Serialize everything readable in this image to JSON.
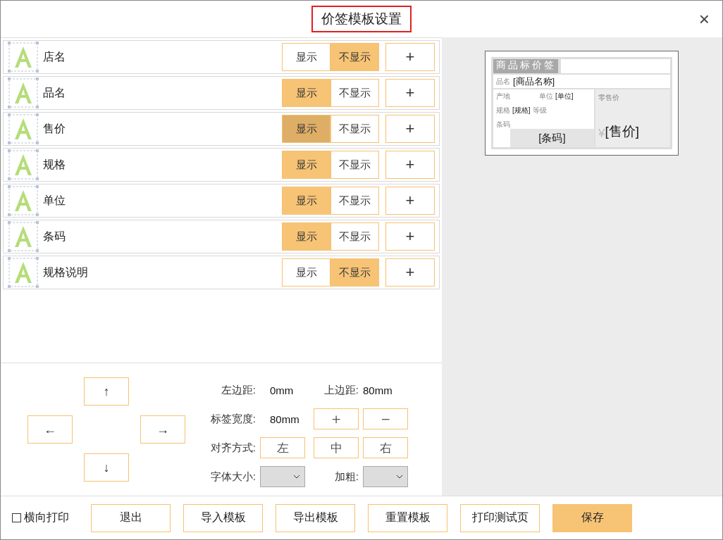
{
  "window": {
    "title": "价签模板设置",
    "close": "×"
  },
  "fields": [
    {
      "name": "店名",
      "show_label": "显示",
      "hide_label": "不显示",
      "shown": false,
      "hovered": false,
      "add": "+"
    },
    {
      "name": "品名",
      "show_label": "显示",
      "hide_label": "不显示",
      "shown": true,
      "hovered": false,
      "add": "+"
    },
    {
      "name": "售价",
      "show_label": "显示",
      "hide_label": "不显示",
      "shown": true,
      "hovered": true,
      "add": "+"
    },
    {
      "name": "规格",
      "show_label": "显示",
      "hide_label": "不显示",
      "shown": true,
      "hovered": false,
      "add": "+"
    },
    {
      "name": "单位",
      "show_label": "显示",
      "hide_label": "不显示",
      "shown": true,
      "hovered": false,
      "add": "+"
    },
    {
      "name": "条码",
      "show_label": "显示",
      "hide_label": "不显示",
      "shown": true,
      "hovered": false,
      "add": "+"
    },
    {
      "name": "规格说明",
      "show_label": "显示",
      "hide_label": "不显示",
      "shown": false,
      "hovered": false,
      "add": "+"
    }
  ],
  "arrows": {
    "up": "↑",
    "left": "←",
    "right": "→",
    "down": "↓"
  },
  "settings": {
    "left_margin_label": "左边距:",
    "left_margin": "0mm",
    "top_margin_label": "上边距:",
    "top_margin": "80mm",
    "width_label": "标签宽度:",
    "width": "80mm",
    "plus": "+",
    "minus": "−",
    "align_label": "对齐方式:",
    "align": [
      "左",
      "中",
      "右"
    ],
    "font_size_label": "字体大小:",
    "bold_label": "加粗:"
  },
  "preview": {
    "title": "商品标价签",
    "name_label": "品名",
    "name_value": "[商品名称]",
    "origin_label": "产地",
    "unit_label": "单位",
    "unit_value": "[单位]",
    "spec_label": "规格",
    "spec_value": "[规格]",
    "grade_label": "等级",
    "barcode_label": "条码",
    "barcode_value": "[条码]",
    "price_label": "零售价",
    "currency": "¥",
    "price_value": "[售价]"
  },
  "footer": {
    "landscape": {
      "label": "横向打印",
      "checked": false
    },
    "buttons": [
      "退出",
      "导入模板",
      "导出模板",
      "重置模板",
      "打印测试页",
      "保存"
    ]
  }
}
